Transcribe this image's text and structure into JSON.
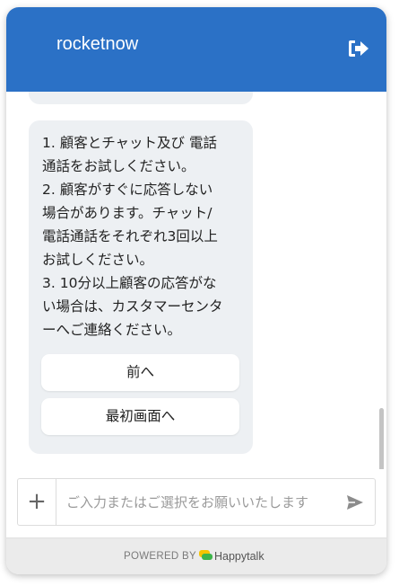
{
  "header": {
    "title": "rocketnow",
    "exit_icon": "sign-out-icon",
    "background_color": "#2b71c6"
  },
  "chat": {
    "message": {
      "text": "1. 顧客とチャット及び 電話\n通話をお試しください。\n2. 顧客がすぐに応答しない\n場合があります。チャット/\n電話通話をそれぞれ3回以上\nお試しください。\n3. 10分以上顧客の応答がな\nい場合は、カスタマーセンタ\nーへご連絡ください。"
    },
    "choices": [
      {
        "label": "前へ"
      },
      {
        "label": "最初画面へ"
      }
    ]
  },
  "composer": {
    "plus_label": "+",
    "placeholder": "ご入力またはご選択をお願いいたします",
    "send_icon": "send-icon"
  },
  "footer": {
    "powered_by": "POWERED BY",
    "brand": "Happytalk",
    "brand_icon": "happytalk-logo-icon"
  }
}
